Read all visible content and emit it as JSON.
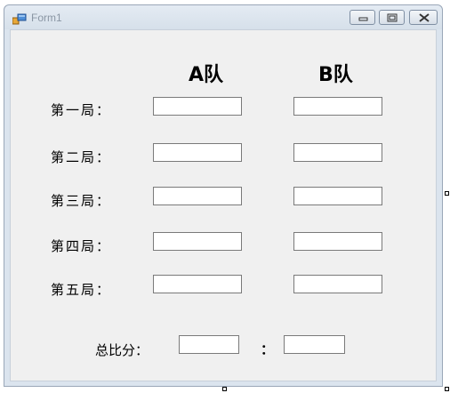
{
  "window": {
    "title": "Form1",
    "icons": {
      "app": "winforms-app-icon",
      "minimize": "minimize-icon",
      "maximize": "maximize-icon",
      "close": "close-icon"
    }
  },
  "headers": {
    "team_a": "A队",
    "team_b": "B队"
  },
  "rounds": [
    {
      "label": "第一局：",
      "a_value": "",
      "b_value": ""
    },
    {
      "label": "第二局：",
      "a_value": "",
      "b_value": ""
    },
    {
      "label": "第三局：",
      "a_value": "",
      "b_value": ""
    },
    {
      "label": "第四局：",
      "a_value": "",
      "b_value": ""
    },
    {
      "label": "第五局：",
      "a_value": "",
      "b_value": ""
    }
  ],
  "total": {
    "label": "总比分：",
    "separator": "：",
    "a_value": "",
    "b_value": ""
  }
}
